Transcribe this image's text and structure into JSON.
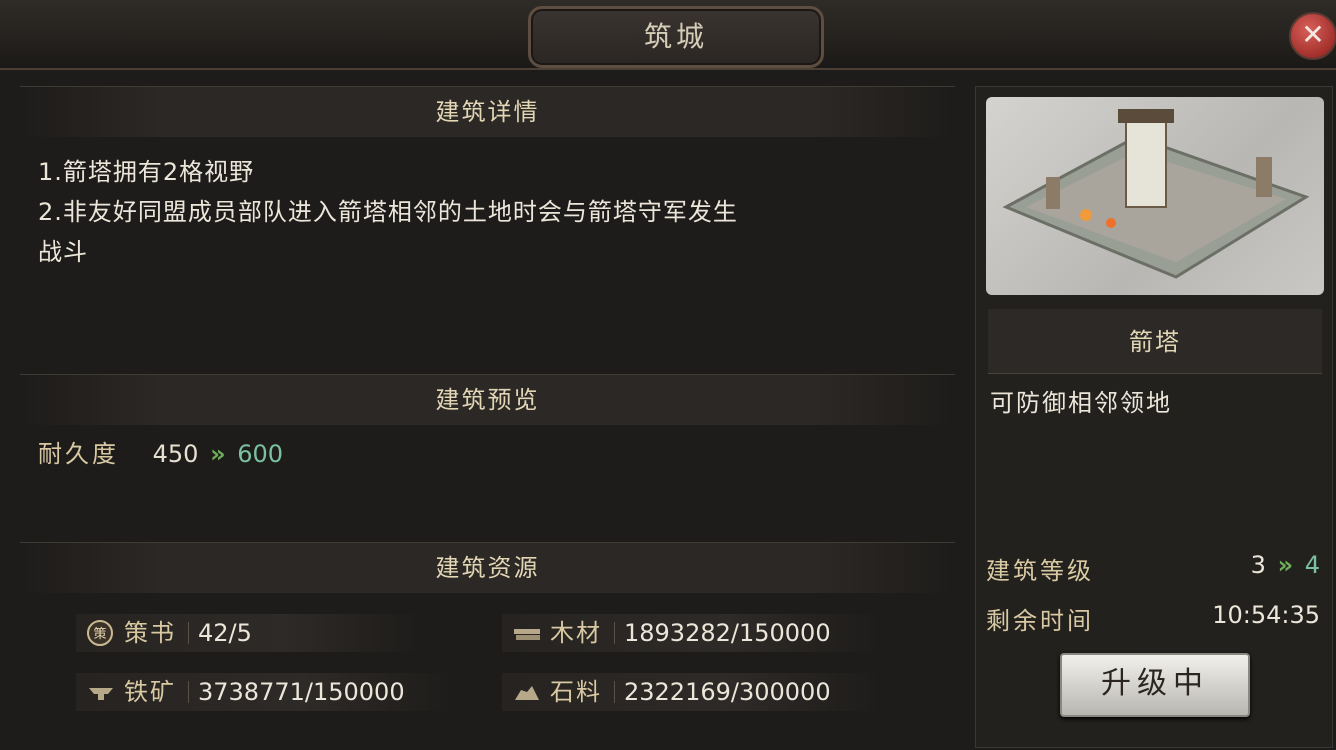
{
  "window": {
    "title": "筑城",
    "close_label": "✕"
  },
  "details": {
    "header": "建筑详情",
    "lines": [
      "1.箭塔拥有2格视野",
      "2.非友好同盟成员部队进入箭塔相邻的土地时会与箭塔守军发生",
      "战斗"
    ]
  },
  "preview": {
    "header": "建筑预览",
    "durability": {
      "label": "耐久度",
      "current": "450",
      "next": "600"
    }
  },
  "resources": {
    "header": "建筑资源",
    "items": [
      {
        "icon": "strategy-book-icon",
        "name": "策书",
        "value": "42/5"
      },
      {
        "icon": "wood-icon",
        "name": "木材",
        "value": "1893282/150000"
      },
      {
        "icon": "iron-ore-icon",
        "name": "铁矿",
        "value": "3738771/150000"
      },
      {
        "icon": "stone-icon",
        "name": "石料",
        "value": "2322169/300000"
      }
    ]
  },
  "building": {
    "name": "箭塔",
    "description": "可防御相邻领地",
    "level_label": "建筑等级",
    "level_current": "3",
    "level_next": "4",
    "time_label": "剩余时间",
    "time_value": "10:54:35",
    "button_label": "升级中"
  },
  "colors": {
    "accent_green": "#6fae5a",
    "header_gold": "#e2d6b5",
    "close_red": "#a3302c"
  }
}
